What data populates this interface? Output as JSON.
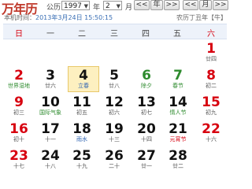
{
  "brand": "万年历",
  "year_label": "公历",
  "year_value": "1997",
  "year_unit": "年",
  "month_value": "2",
  "month_unit": "月",
  "nav": [
    "<<",
    "年",
    ">>",
    "<<",
    "月",
    ">>"
  ],
  "time_label": "本机时间：",
  "time_value": "2013年3月24日 15:50:15",
  "lunar_info": "农历丁丑年【牛】",
  "weekdays": [
    "日",
    "一",
    "二",
    "三",
    "四",
    "五",
    "六"
  ],
  "weeks": [
    [
      {
        "day": "",
        "sub": ""
      },
      {
        "day": "",
        "sub": ""
      },
      {
        "day": "",
        "sub": ""
      },
      {
        "day": "",
        "sub": ""
      },
      {
        "day": "",
        "sub": ""
      },
      {
        "day": "",
        "sub": ""
      },
      {
        "day": "1",
        "sub": "廿四"
      }
    ],
    [
      {
        "day": "2",
        "sub": "世界湿地"
      },
      {
        "day": "3",
        "sub": "廿六"
      },
      {
        "day": "4",
        "sub": "立春"
      },
      {
        "day": "5",
        "sub": "廿八"
      },
      {
        "day": "6",
        "sub": "除夕"
      },
      {
        "day": "7",
        "sub": "春节"
      },
      {
        "day": "8",
        "sub": "初二"
      }
    ],
    [
      {
        "day": "9",
        "sub": "初三"
      },
      {
        "day": "10",
        "sub": "国际气象"
      },
      {
        "day": "11",
        "sub": "初五"
      },
      {
        "day": "12",
        "sub": "初六"
      },
      {
        "day": "13",
        "sub": "初七"
      },
      {
        "day": "14",
        "sub": "情人节"
      },
      {
        "day": "15",
        "sub": "初九"
      }
    ],
    [
      {
        "day": "16",
        "sub": "初十"
      },
      {
        "day": "17",
        "sub": "十一"
      },
      {
        "day": "18",
        "sub": "雨水"
      },
      {
        "day": "19",
        "sub": "十三"
      },
      {
        "day": "20",
        "sub": "十四"
      },
      {
        "day": "21",
        "sub": "元宵节"
      },
      {
        "day": "22",
        "sub": "十六"
      }
    ],
    [
      {
        "day": "23",
        "sub": "十七"
      },
      {
        "day": "24",
        "sub": "十八"
      },
      {
        "day": "25",
        "sub": "十九"
      },
      {
        "day": "26",
        "sub": "二十"
      },
      {
        "day": "27",
        "sub": "廿一"
      },
      {
        "day": "28",
        "sub": "廿二"
      },
      {
        "day": "",
        "sub": ""
      }
    ]
  ],
  "colors": {
    "brand": "#c0392b",
    "weekend": "#d7000f",
    "term": "#2e8b2e",
    "today_bg": "#fdf0c0",
    "header_bg": "#edf2fa"
  }
}
